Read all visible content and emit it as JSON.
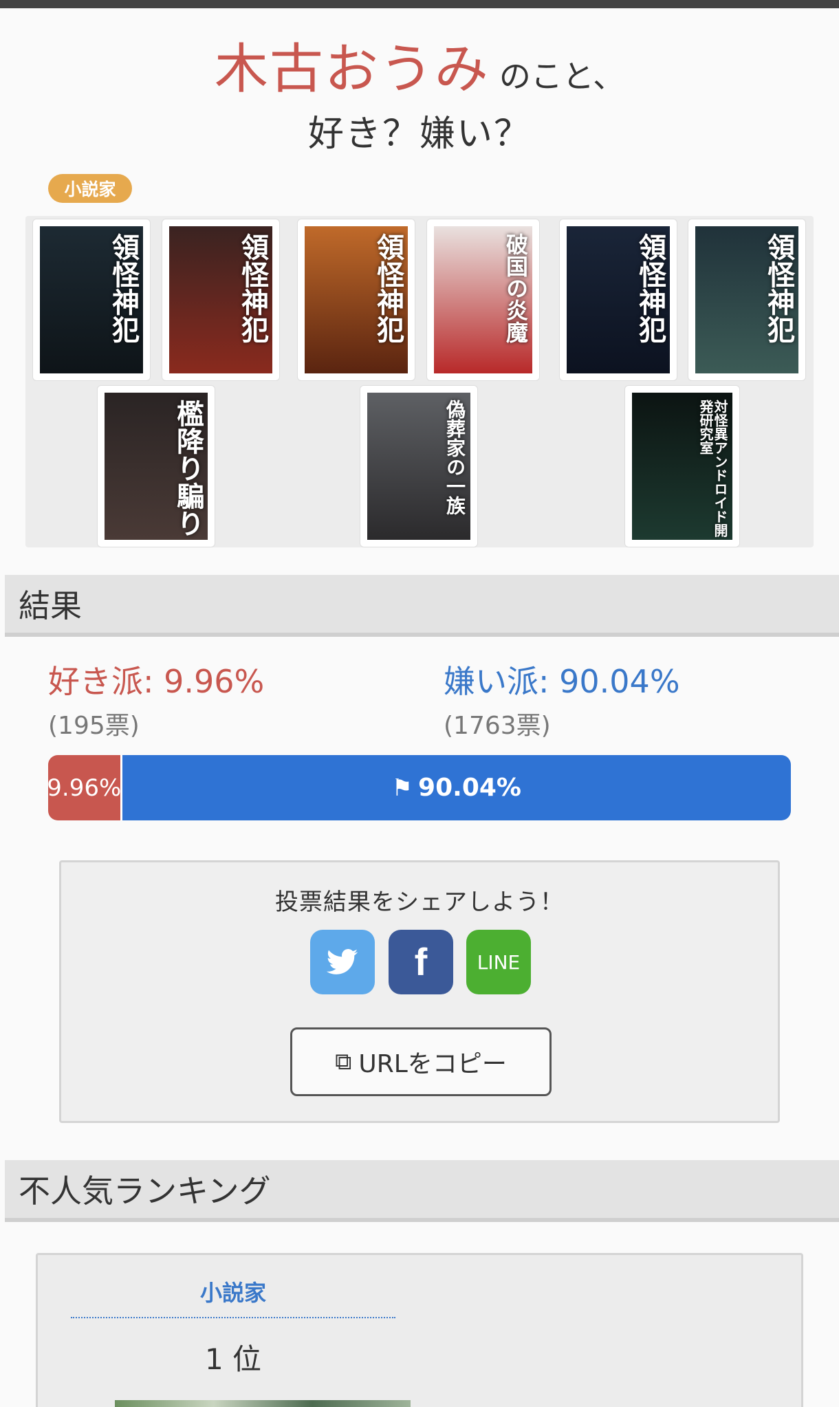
{
  "header": {
    "name": "木古おうみ",
    "suffix": "のこと、",
    "question": "好き？嫌い？",
    "category_badge": "小説家"
  },
  "books": [
    {
      "title": "領怪神犯",
      "color_top": "#1d2a33",
      "color_bottom": "#0e1418"
    },
    {
      "title": "領怪神犯",
      "color_top": "#3a2321",
      "color_bottom": "#8a2a1e"
    },
    {
      "title": "領怪神犯",
      "color_top": "#c06a2a",
      "color_bottom": "#5a2410"
    },
    {
      "title": "破国の炎魔",
      "color_top": "#e9e1df",
      "color_bottom": "#b82929"
    },
    {
      "title": "領怪神犯",
      "color_top": "#1a2538",
      "color_bottom": "#0c1220"
    },
    {
      "title": "領怪神犯",
      "color_top": "#20323a",
      "color_bottom": "#3c5b56"
    },
    {
      "title": "檻降り騙り",
      "color_top": "#2a2424",
      "color_bottom": "#4a3a36"
    },
    {
      "title": "偽葬家の一族",
      "color_top": "#5e6064",
      "color_bottom": "#2b2a2c"
    },
    {
      "title": "対怪異アンドロイド開発研究室",
      "color_top": "#0c1412",
      "color_bottom": "#1d3a30"
    }
  ],
  "result_section": {
    "heading": "結果"
  },
  "results": {
    "like": {
      "label": "好き派",
      "percent_text": "9.96%",
      "votes": "(195票)",
      "percent": 9.96,
      "color": "#c8574f"
    },
    "dislike": {
      "label": "嫌い派",
      "percent_text": "90.04%",
      "votes": "(1763票)",
      "percent": 90.04,
      "color": "#2f73d4"
    }
  },
  "bar": {
    "like_text": "9.96%",
    "dislike_text": "90.04%"
  },
  "share": {
    "title": "投票結果をシェアしよう！",
    "twitter_color": "#5ea9ea",
    "facebook_color": "#3b5998",
    "line_label": "LINE",
    "line_color": "#4caf31",
    "copy_label": "URLをコピー"
  },
  "ranking_section": {
    "heading": "不人気ランキング"
  },
  "ranking": {
    "category": "小説家",
    "position": "1 位"
  }
}
